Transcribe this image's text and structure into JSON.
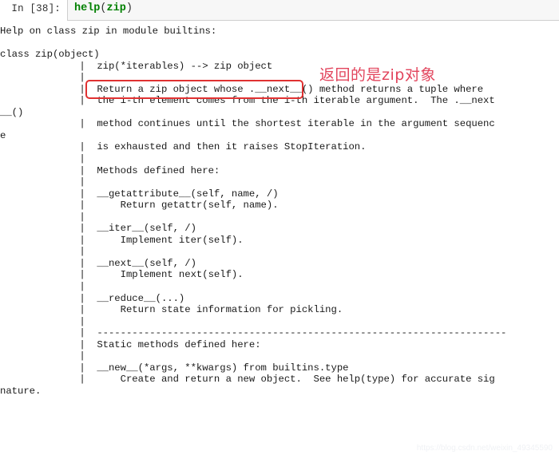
{
  "notebook": {
    "input_prompt": "In [38]:",
    "code": {
      "func_name": "help",
      "open_paren": "(",
      "arg_name": "zip",
      "close_paren": ")",
      "full_text": "help(zip)"
    },
    "output_lines": [
      "Help on class zip in module builtins:",
      "",
      "class zip(object)",
      " |  zip(*iterables) --> zip object",
      " |  ",
      " |  Return a zip object whose .__next__() method returns a tuple where",
      " |  the i-th element comes from the i-th iterable argument.  The .__next",
      "__()",
      " |  method continues until the shortest iterable in the argument sequenc",
      "e",
      " |  is exhausted and then it raises StopIteration.",
      " |  ",
      " |  Methods defined here:",
      " |  ",
      " |  __getattribute__(self, name, /)",
      " |      Return getattr(self, name).",
      " |  ",
      " |  __iter__(self, /)",
      " |      Implement iter(self).",
      " |  ",
      " |  __next__(self, /)",
      " |      Implement next(self).",
      " |  ",
      " |  __reduce__(...)",
      " |      Return state information for pickling.",
      " |  ",
      " |  ----------------------------------------------------------------------",
      " |  Static methods defined here:",
      " |  ",
      " |  __new__(*args, **kwargs) from builtins.type",
      " |      Create and return a new object.  See help(type) for accurate sig",
      "nature."
    ]
  },
  "annotations": {
    "highlight_note": "返回的是zip对象",
    "highlighted_code_line": "zip(*iterables) --> zip object",
    "accent_color": "#e03131",
    "note_color": "#e2445c"
  },
  "watermark": {
    "text": "https://blog.csdn.net/weixin_49345590"
  }
}
